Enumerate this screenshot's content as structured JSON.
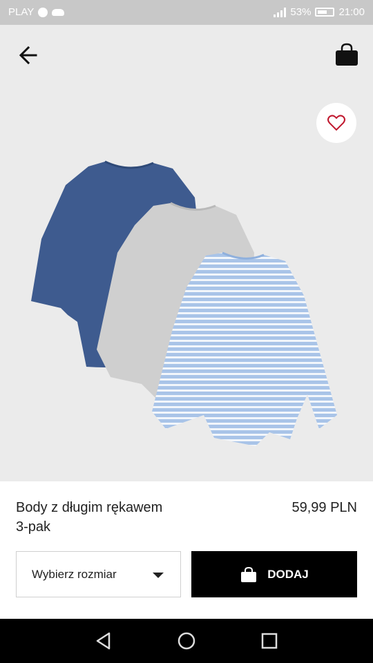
{
  "status_bar": {
    "carrier": "PLAY",
    "battery": "53%",
    "time": "21:00"
  },
  "header": {
    "back_icon": "arrow-left-icon",
    "bag_icon": "shopping-bag-icon"
  },
  "favorite_icon": "heart-icon",
  "product": {
    "name_line1": "Body z długim rękawem",
    "name_line2": "3-pak",
    "price": "59,99 PLN"
  },
  "actions": {
    "size_placeholder": "Wybierz rozmiar",
    "add_label": "DODAJ"
  },
  "colors": {
    "background": "#ebebeb",
    "add_button": "#000000",
    "navy": "#3e5b8f",
    "grey": "#cfcfcf",
    "light_blue": "#a9c4e8"
  }
}
